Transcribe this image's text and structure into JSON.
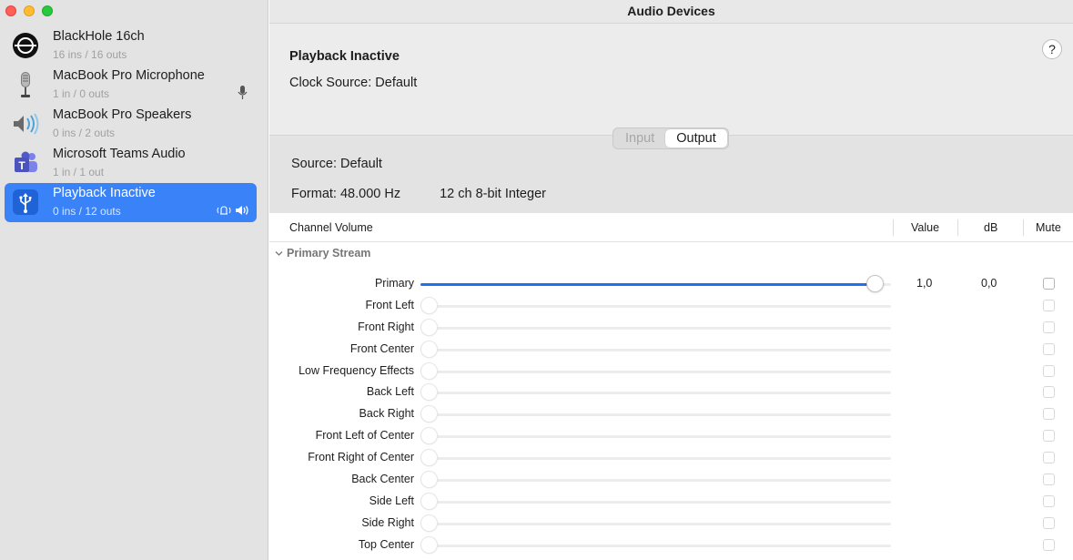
{
  "window": {
    "title": "Audio Devices"
  },
  "sidebar": {
    "devices": [
      {
        "name": "BlackHole 16ch",
        "io": "16 ins / 16 outs",
        "icon": "blackhole-icon",
        "selected": false,
        "right_icon": ""
      },
      {
        "name": "MacBook Pro Microphone",
        "io": "1 in / 0 outs",
        "icon": "microphone-icon",
        "selected": false,
        "right_icon": "microphone-input-icon"
      },
      {
        "name": "MacBook Pro Speakers",
        "io": "0 ins / 2 outs",
        "icon": "speaker-icon",
        "selected": false,
        "right_icon": ""
      },
      {
        "name": "Microsoft Teams Audio",
        "io": "1 in / 1 out",
        "icon": "teams-icon",
        "selected": false,
        "right_icon": ""
      },
      {
        "name": "Playback Inactive",
        "io": "0 ins / 12 outs",
        "icon": "usb-icon",
        "selected": true,
        "right_icon": "alert-and-output-icons"
      }
    ]
  },
  "header": {
    "device_title": "Playback Inactive",
    "clock_source": "Clock Source:  Default",
    "help_label": "?"
  },
  "tabs": {
    "input": "Input",
    "output": "Output",
    "active": "Output"
  },
  "stream_info": {
    "source": "Source:  Default",
    "format": "Format:  48.000 Hz",
    "format_detail": "12 ch 8-bit Integer"
  },
  "table": {
    "headers": {
      "channel": "Channel Volume",
      "value": "Value",
      "db": "dB",
      "mute": "Mute"
    },
    "group": "Primary Stream",
    "channels": [
      {
        "name": "Primary",
        "level": 1.0,
        "value": "1,0",
        "db": "0,0",
        "active": true
      },
      {
        "name": "Front Left",
        "level": 0,
        "value": "",
        "db": "",
        "active": false
      },
      {
        "name": "Front Right",
        "level": 0,
        "value": "",
        "db": "",
        "active": false
      },
      {
        "name": "Front Center",
        "level": 0,
        "value": "",
        "db": "",
        "active": false
      },
      {
        "name": "Low Frequency Effects",
        "level": 0,
        "value": "",
        "db": "",
        "active": false
      },
      {
        "name": "Back Left",
        "level": 0,
        "value": "",
        "db": "",
        "active": false
      },
      {
        "name": "Back Right",
        "level": 0,
        "value": "",
        "db": "",
        "active": false
      },
      {
        "name": "Front Left of Center",
        "level": 0,
        "value": "",
        "db": "",
        "active": false
      },
      {
        "name": "Front Right of Center",
        "level": 0,
        "value": "",
        "db": "",
        "active": false
      },
      {
        "name": "Back Center",
        "level": 0,
        "value": "",
        "db": "",
        "active": false
      },
      {
        "name": "Side Left",
        "level": 0,
        "value": "",
        "db": "",
        "active": false
      },
      {
        "name": "Side Right",
        "level": 0,
        "value": "",
        "db": "",
        "active": false
      },
      {
        "name": "Top Center",
        "level": 0,
        "value": "",
        "db": "",
        "active": false
      }
    ]
  },
  "colors": {
    "accent": "#1e6ff1",
    "selection": "#3a82f7",
    "sidebar_bg": "#e3e3e3"
  }
}
